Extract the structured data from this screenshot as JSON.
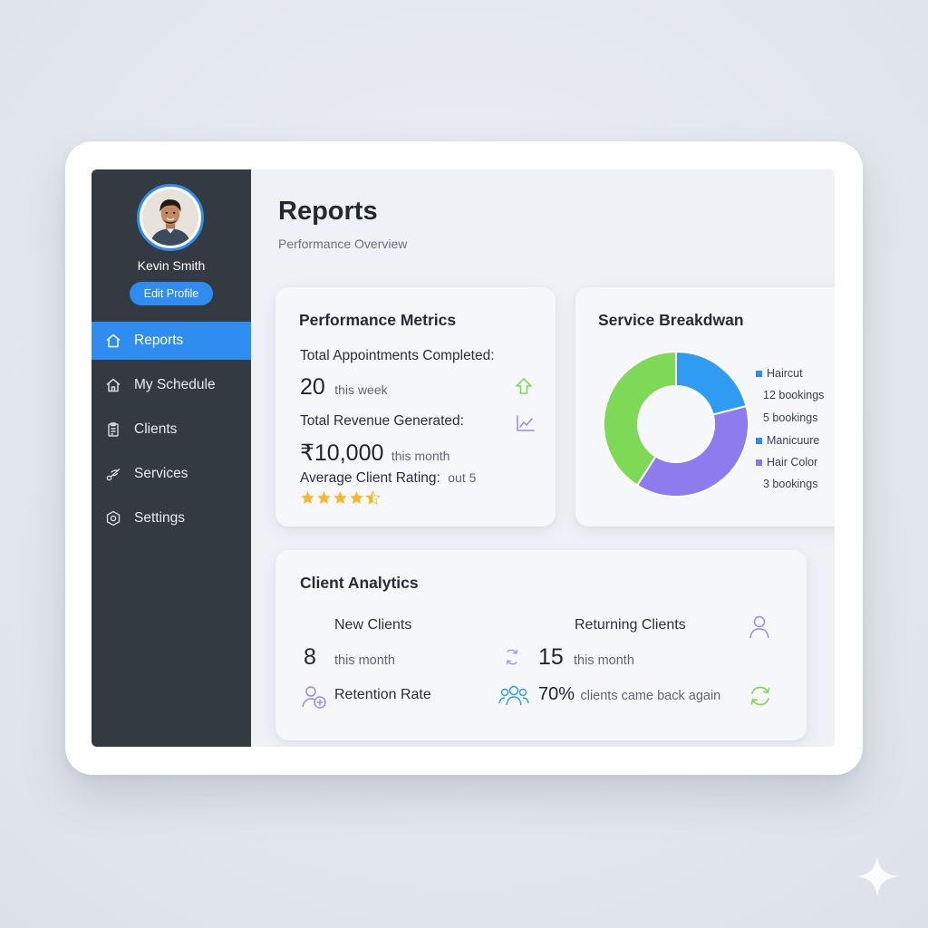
{
  "profile": {
    "name": "Kevin Smith",
    "edit_label": "Edit Profile"
  },
  "nav": [
    {
      "label": "Reports",
      "icon": "home-icon",
      "active": true
    },
    {
      "label": "My Schedule",
      "icon": "home-icon"
    },
    {
      "label": "Clients",
      "icon": "clipboard-icon"
    },
    {
      "label": "Services",
      "icon": "scissors-icon"
    },
    {
      "label": "Settings",
      "icon": "gear-icon"
    }
  ],
  "page": {
    "title": "Reports",
    "subtitle": "Performance Overview"
  },
  "metrics": {
    "title": "Performance Metrics",
    "appointments_label": "Total Appointments Completed:",
    "appointments_value": "20",
    "appointments_period": "this week",
    "revenue_label": "Total Revenue Generated:",
    "revenue_value": "₹10,000",
    "revenue_period": "this month",
    "rating_label": "Average Client Rating:",
    "rating_suffix": "out 5",
    "rating_value": 4.5,
    "rating_max": 5
  },
  "service": {
    "title": "Service Breakdwan",
    "legend": [
      {
        "text": "Haircut",
        "swatch": "#2f8df2"
      },
      {
        "text": "12 bookings",
        "swatch": ""
      },
      {
        "text": "5 bookings",
        "swatch": ""
      },
      {
        "text": "Manicuure",
        "swatch": "#2f8df2"
      },
      {
        "text": "Hair Color",
        "swatch": "#8b78ea"
      },
      {
        "text": "3 bookings",
        "swatch": ""
      }
    ]
  },
  "chart_data": {
    "type": "pie",
    "donut": true,
    "slices": [
      {
        "value": 0.21,
        "color": "#2f9bf3"
      },
      {
        "value": 0.38,
        "color": "#8e7bee"
      },
      {
        "value": 0.41,
        "color": "#7ed957"
      }
    ]
  },
  "clients": {
    "title": "Client Analytics",
    "new_label": "New Clients",
    "new_value": "8",
    "new_period": "this month",
    "returning_label": "Returning Clients",
    "returning_value": "15",
    "returning_period": "this month",
    "retention_label": "Retention Rate",
    "retention_value": "70%",
    "retention_text": "clients came back again"
  },
  "colors": {
    "accent": "#2f8df2",
    "sidebar": "#343a42",
    "green": "#7ed957",
    "purple": "#8e7bee",
    "star": "#f5b928"
  }
}
